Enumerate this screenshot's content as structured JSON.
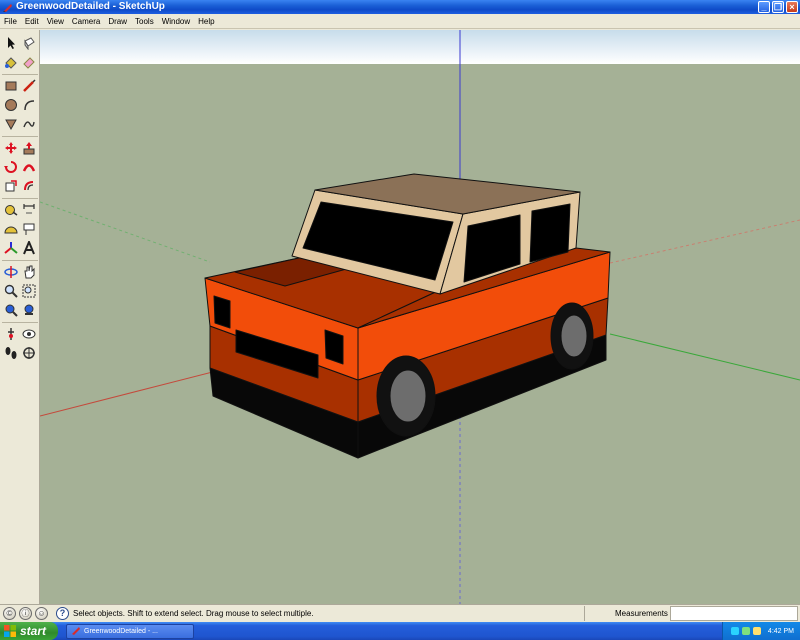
{
  "window": {
    "title": "GreenwoodDetailed - SketchUp",
    "minimize_glyph": "_",
    "maximize_glyph": "❐",
    "close_glyph": "×"
  },
  "menu": [
    "File",
    "Edit",
    "View",
    "Camera",
    "Draw",
    "Tools",
    "Window",
    "Help"
  ],
  "toolbar": {
    "tools": [
      "select-tool",
      "component-tool",
      "paint-bucket-tool",
      "eraser-tool",
      "rectangle-tool",
      "line-tool",
      "circle-tool",
      "arc-tool",
      "polygon-tool",
      "freehand-tool",
      "move-tool",
      "push-pull-tool",
      "rotate-tool",
      "follow-me-tool",
      "scale-tool",
      "offset-tool",
      "tape-measure-tool",
      "dimension-tool",
      "protractor-tool",
      "text-tool",
      "axes-tool",
      "3d-text-tool",
      "orbit-tool",
      "pan-tool",
      "zoom-tool",
      "zoom-window-tool",
      "zoom-extents-tool",
      "previous-view-tool",
      "position-camera-tool",
      "look-around-tool",
      "walk-tool",
      "section-plane-tool"
    ]
  },
  "status": {
    "message": "Select objects. Shift to extend select. Drag mouse to select multiple.",
    "measurements_label": "Measurements",
    "measurements_value": ""
  },
  "taskbar": {
    "start_label": "start",
    "task_label": "GreenwoodDetailed - ...",
    "clock": "4:42 PM"
  },
  "colors": {
    "sky": "#ffffff",
    "ground": "#a5b196",
    "body_orange": "#f24d0a",
    "body_dark": "#a83000",
    "roof": "#8b7157",
    "cabin": "#e2c8a0",
    "axis_red": "#c44a3c",
    "axis_green": "#3aa83a",
    "axis_blue": "#3a3ad0"
  }
}
